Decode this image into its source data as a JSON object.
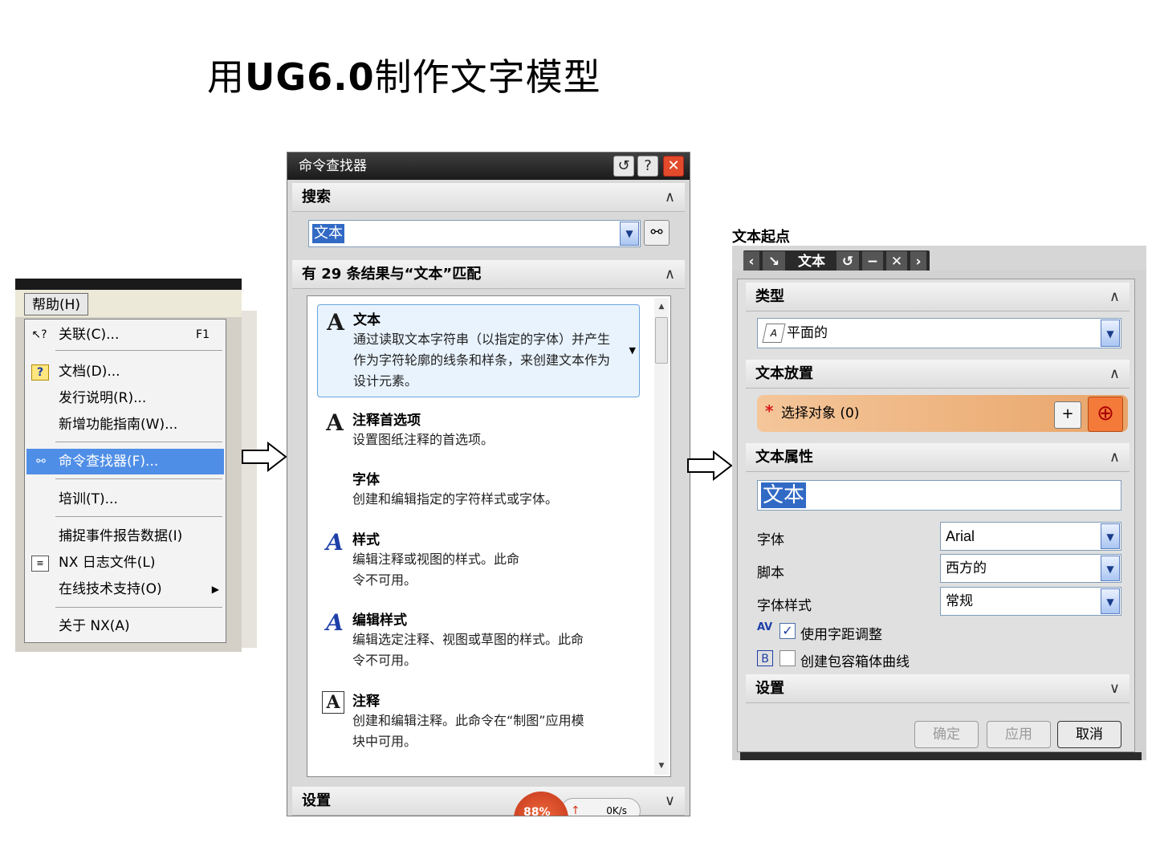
{
  "slide": {
    "title_prefix": "用",
    "title_bold": "UG6.0",
    "title_suffix": "制作文字模型"
  },
  "help_menu": {
    "menu_label": "帮助(H)",
    "items": [
      {
        "label": "关联(C)...",
        "shortcut": "F1",
        "icon": "context-help-icon"
      },
      {
        "label": "文档(D)...",
        "icon": "documentation-icon"
      },
      {
        "label": "发行说明(R)..."
      },
      {
        "label": "新增功能指南(W)..."
      },
      {
        "label": "命令查找器(F)...",
        "icon": "binoculars-icon",
        "selected": true
      },
      {
        "label": "培训(T)..."
      },
      {
        "label": "捕捉事件报告数据(I)"
      },
      {
        "label": "NX 日志文件(L)",
        "icon": "log-file-icon"
      },
      {
        "label": "在线技术支持(O)",
        "submenu": true
      },
      {
        "label": "关于 NX(A)"
      }
    ]
  },
  "command_finder": {
    "title": "命令查找器",
    "search_section": "搜索",
    "search_value": "文本",
    "results_header": "有 29 条结果与“文本”匹配",
    "results": [
      {
        "name": "文本",
        "icon": "A",
        "desc": "通过读取文本字符串（以指定的字体）并产生作为字符轮廓的线条和样条，来创建文本作为设计元素。",
        "highlight": true
      },
      {
        "name": "注释首选项",
        "icon": "A",
        "desc": "设置图纸注释的首选项。"
      },
      {
        "name": "字体",
        "icon": "",
        "desc": "创建和编辑指定的字符样式或字体。"
      },
      {
        "name": "样式",
        "icon": "A",
        "desc": "编辑注释或视图的样式。此命令不可用。"
      },
      {
        "name": "编辑样式",
        "icon": "A",
        "desc": "编辑选定注释、视图或草图的样式。此命令不可用。"
      },
      {
        "name": "注释",
        "icon": "A",
        "desc": "创建和编辑注释。此命令在“制图”应用模块中可用。"
      }
    ],
    "settings_section": "设置",
    "network_percent": "88%",
    "network_speed": "0K/s"
  },
  "text_dialog": {
    "window_label": "文本起点",
    "toolbar_title": "文本",
    "type_section": "类型",
    "type_value": "平面的",
    "placement_section": "文本放置",
    "select_object": "选择对象 (0)",
    "properties_section": "文本属性",
    "text_value": "文本",
    "font_label": "字体",
    "font_value": "Arial",
    "script_label": "脚本",
    "script_value": "西方的",
    "style_label": "字体样式",
    "style_value": "常规",
    "kerning_label": "使用字距调整",
    "kerning_checked": true,
    "bbox_label": "创建包容箱体曲线",
    "bbox_checked": false,
    "settings_section": "设置",
    "ok_label": "确定",
    "apply_label": "应用",
    "cancel_label": "取消"
  }
}
